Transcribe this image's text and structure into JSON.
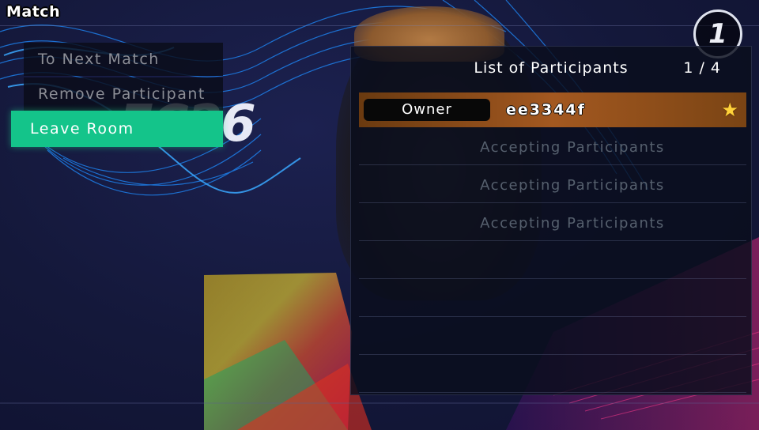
{
  "header": {
    "title": "Match",
    "icon": "game-logo-icon"
  },
  "background": {
    "logo_text": "FC26",
    "colors": {
      "base": "#141838",
      "accent_blue": "#1e8cff",
      "accent_magenta": "#d0287a"
    }
  },
  "menu": {
    "items": [
      {
        "label": "To Next Match",
        "selected": false
      },
      {
        "label": "Remove Participant",
        "selected": false
      },
      {
        "label": "Leave Room",
        "selected": true
      }
    ],
    "selected_color": "#14c48a"
  },
  "participants": {
    "title": "List of Participants",
    "count": "1 / 4",
    "owner": {
      "role": "Owner",
      "name": "ee3344f",
      "icon": "star-icon"
    },
    "slots": [
      {
        "text": "Accepting Participants"
      },
      {
        "text": "Accepting Participants"
      },
      {
        "text": "Accepting Participants"
      }
    ]
  }
}
